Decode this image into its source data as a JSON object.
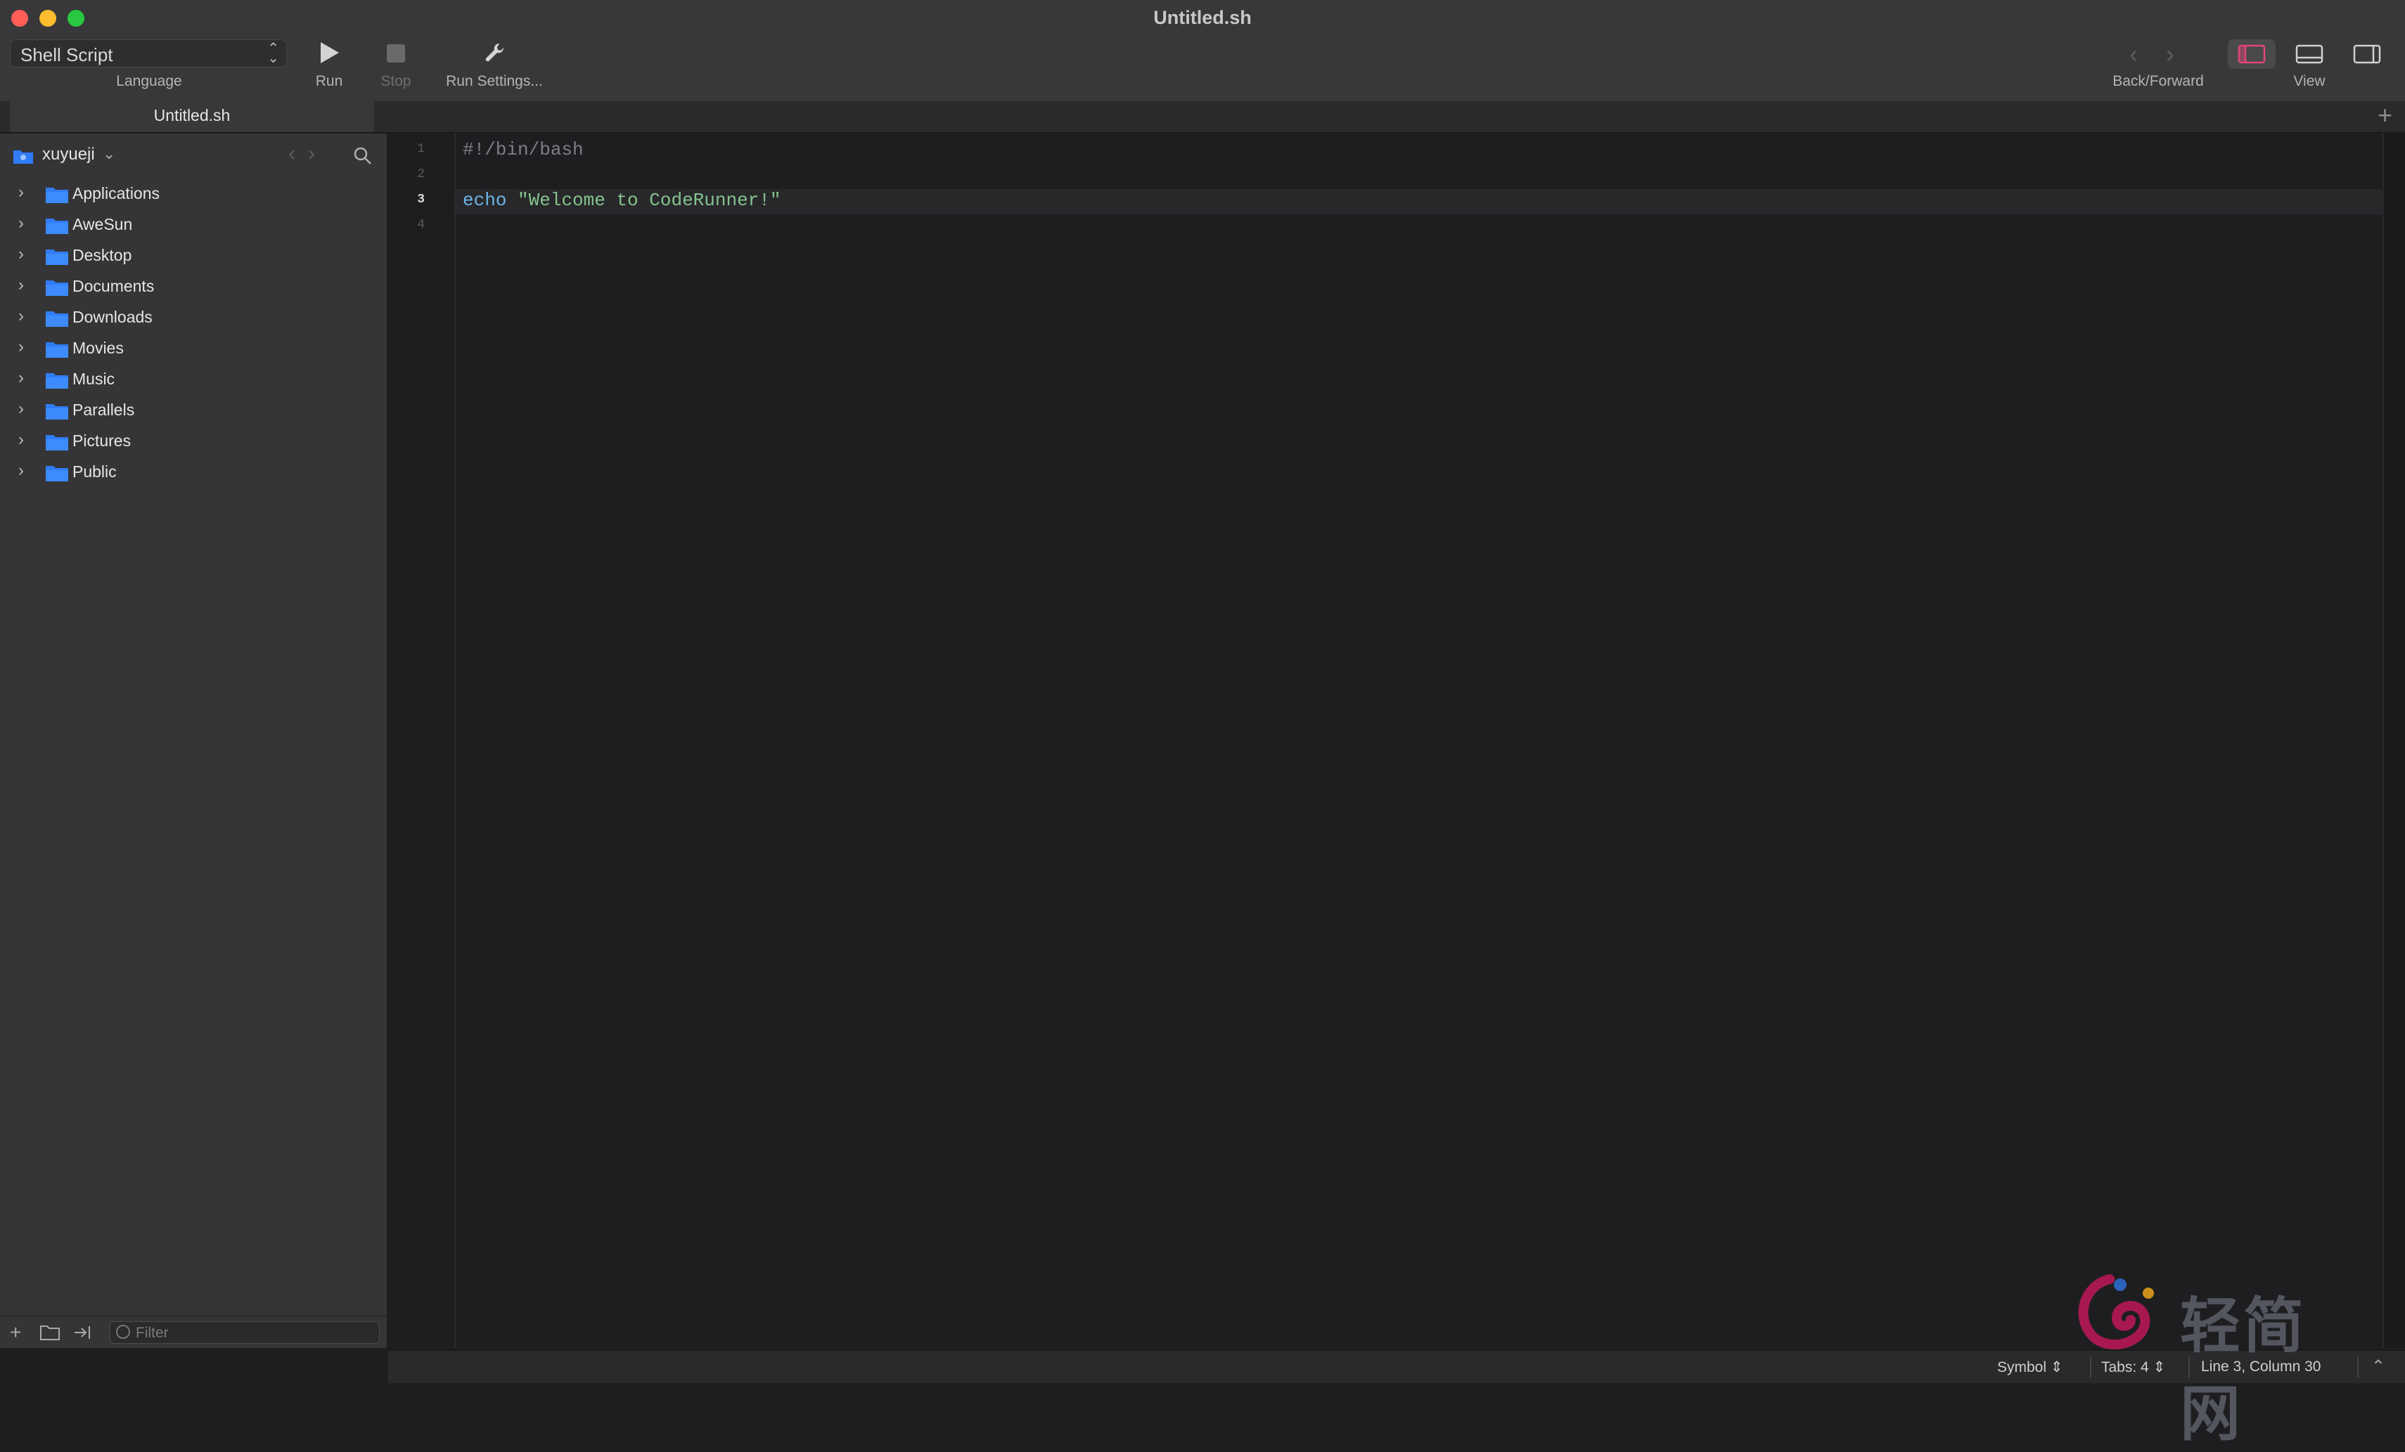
{
  "window": {
    "title": "Untitled.sh"
  },
  "toolbar": {
    "language_value": "Shell Script",
    "language_label": "Language",
    "run_label": "Run",
    "stop_label": "Stop",
    "run_settings_label": "Run Settings...",
    "back_forward_label": "Back/Forward",
    "view_label": "View"
  },
  "tabs": [
    {
      "label": "Untitled.sh",
      "active": true
    }
  ],
  "sidebar": {
    "root_name": "xuyueji",
    "items": [
      {
        "label": "Applications"
      },
      {
        "label": "AweSun"
      },
      {
        "label": "Desktop"
      },
      {
        "label": "Documents"
      },
      {
        "label": "Downloads"
      },
      {
        "label": "Movies"
      },
      {
        "label": "Music"
      },
      {
        "label": "Parallels"
      },
      {
        "label": "Pictures"
      },
      {
        "label": "Public"
      }
    ],
    "filter_placeholder": "Filter"
  },
  "editor": {
    "line_numbers": [
      "1",
      "2",
      "3",
      "4"
    ],
    "current_line": 3,
    "lines": [
      {
        "comment": "#!/bin/bash"
      },
      {},
      {
        "keyword": "echo",
        "space": " ",
        "string": "\"Welcome to CodeRunner!\""
      },
      {}
    ]
  },
  "statusbar": {
    "symbol": "Symbol",
    "tabs": "Tabs: 4",
    "position": "Line 3, Column 30"
  },
  "watermark": {
    "text": "轻简网"
  },
  "colors": {
    "folder_blue": "#2f7cf6",
    "keyword": "#6cb4e6",
    "string": "#84c38d",
    "comment": "#7c7f86",
    "view_active": "#e0457b"
  }
}
